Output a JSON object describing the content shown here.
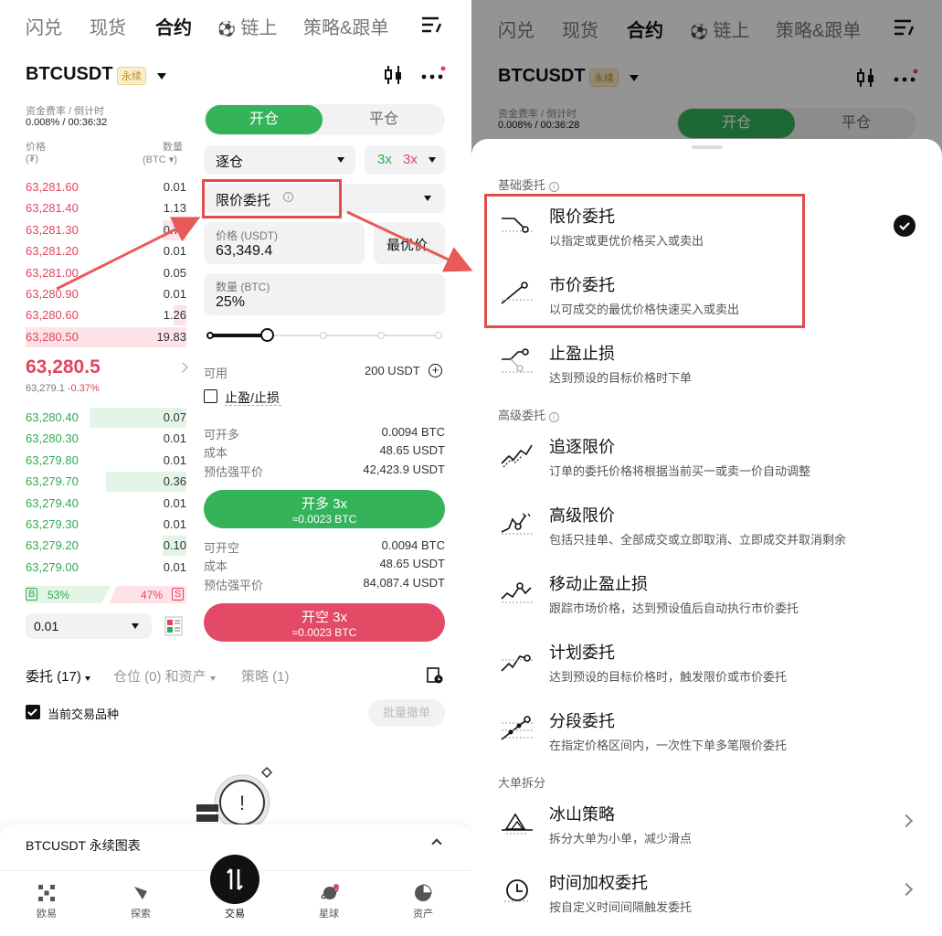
{
  "top_nav": [
    "闪兑",
    "现货",
    "合约",
    "链上",
    "策略&跟单"
  ],
  "symbol": "BTCUSDT",
  "perp_badge": "永续",
  "funding": {
    "label": "资金费率 / 倒计时",
    "value_left": "0.008% / 00:36:32",
    "value_right": "0.008% / 00:36:28"
  },
  "orderbook": {
    "price_header": "价格",
    "price_unit": "(₮)",
    "qty_header": "数量",
    "qty_unit": "(BTC ▾)",
    "asks": [
      {
        "price": "63,281.60",
        "qty": "0.01"
      },
      {
        "price": "63,281.40",
        "qty": "1.13"
      },
      {
        "price": "63,281.30",
        "qty": "0.78"
      },
      {
        "price": "63,281.20",
        "qty": "0.01"
      },
      {
        "price": "63,281.00",
        "qty": "0.05"
      },
      {
        "price": "63,280.90",
        "qty": "0.01"
      },
      {
        "price": "63,280.60",
        "qty": "1.26"
      },
      {
        "price": "63,280.50",
        "qty": "19.83"
      }
    ],
    "last_price": "63,280.5",
    "mark_price": "63,279.1",
    "change": "-0.37%",
    "bids": [
      {
        "price": "63,280.40",
        "qty": "0.07"
      },
      {
        "price": "63,280.30",
        "qty": "0.01"
      },
      {
        "price": "63,279.80",
        "qty": "0.01"
      },
      {
        "price": "63,279.70",
        "qty": "0.36"
      },
      {
        "price": "63,279.40",
        "qty": "0.01"
      },
      {
        "price": "63,279.30",
        "qty": "0.01"
      },
      {
        "price": "63,279.20",
        "qty": "0.10"
      },
      {
        "price": "63,279.00",
        "qty": "0.01"
      }
    ],
    "buy_label": "B",
    "buy_pct": "53%",
    "sell_pct": "47%",
    "sell_label": "S",
    "tick": "0.01"
  },
  "trade": {
    "open_tab": "开仓",
    "close_tab": "平仓",
    "margin_mode": "逐仓",
    "lev_long": "3x",
    "lev_short": "3x",
    "order_type": "限价委托",
    "price_label": "价格 (USDT)",
    "price_value": "63,349.4",
    "best_price": "最优价",
    "qty_label": "数量 (BTC)",
    "qty_value": "25%",
    "avail_label": "可用",
    "avail_value": "200 USDT",
    "tpsl": "止盈/止损",
    "long_max_label": "可开多",
    "long_max": "0.0094 BTC",
    "cost_label": "成本",
    "cost_long": "48.65 USDT",
    "liq_label": "预估强平价",
    "liq_long": "42,423.9 USDT",
    "open_long": "开多 3x",
    "open_long_sub": "≈0.0023 BTC",
    "short_max_label": "可开空",
    "short_max": "0.0094 BTC",
    "cost_short": "48.65 USDT",
    "liq_short": "84,087.4 USDT",
    "open_short": "开空 3x",
    "open_short_sub": "≈0.0023 BTC"
  },
  "orders_tabs": {
    "orders": "委托 (17)",
    "positions": "仓位 (0) 和资产",
    "strategy": "策略 (1)"
  },
  "current_only": "当前交易品种",
  "batch_cancel": "批量撤单",
  "chart_bar": "BTCUSDT 永续图表",
  "bottom_nav": [
    "欧易",
    "探索",
    "交易",
    "星球",
    "资产"
  ],
  "sheet": {
    "section_basic": "基础委托",
    "section_adv": "高级委托",
    "section_split": "大单拆分",
    "options": [
      {
        "title": "限价委托",
        "desc": "以指定或更优价格买入或卖出"
      },
      {
        "title": "市价委托",
        "desc": "以可成交的最优价格快速买入或卖出"
      },
      {
        "title": "止盈止损",
        "desc": "达到预设的目标价格时下单"
      },
      {
        "title": "追逐限价",
        "desc": "订单的委托价格将根据当前买一或卖一价自动调整"
      },
      {
        "title": "高级限价",
        "desc": "包括只挂单、全部成交或立即取消、立即成交并取消剩余"
      },
      {
        "title": "移动止盈止损",
        "desc": "跟踪市场价格，达到预设值后自动执行市价委托"
      },
      {
        "title": "计划委托",
        "desc": "达到预设的目标价格时，触发限价或市价委托"
      },
      {
        "title": "分段委托",
        "desc": "在指定价格区间内，一次性下单多笔限价委托"
      },
      {
        "title": "冰山策略",
        "desc": "拆分大单为小单，减少滑点"
      },
      {
        "title": "时间加权委托",
        "desc": "按自定义时间间隔触发委托"
      }
    ]
  }
}
